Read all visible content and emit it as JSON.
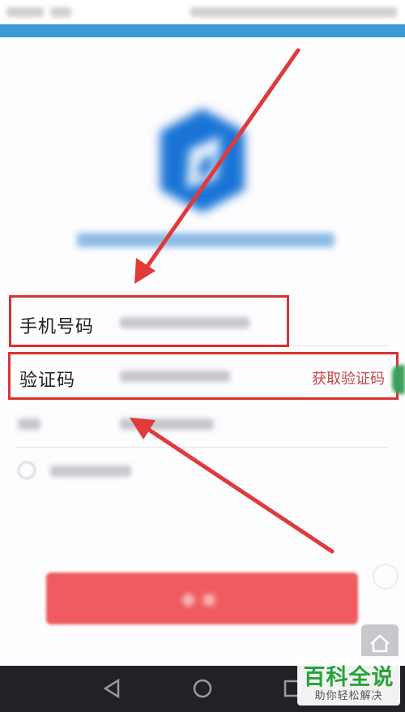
{
  "form": {
    "phone_label": "手机号码",
    "code_label": "验证码",
    "get_code_link": "获取验证码"
  },
  "watermark": {
    "title": "百科全说",
    "subtitle": "助你轻松解决"
  },
  "colors": {
    "accent_red": "#ef5b5f",
    "annotation_red": "#d93131",
    "link_red": "#c24a4a",
    "brand_blue": "#1a74d6",
    "header_blue": "#3a9ad8"
  },
  "icons": {
    "nav_back": "back-triangle-icon",
    "nav_home": "home-circle-icon",
    "nav_recent": "recent-square-icon"
  }
}
